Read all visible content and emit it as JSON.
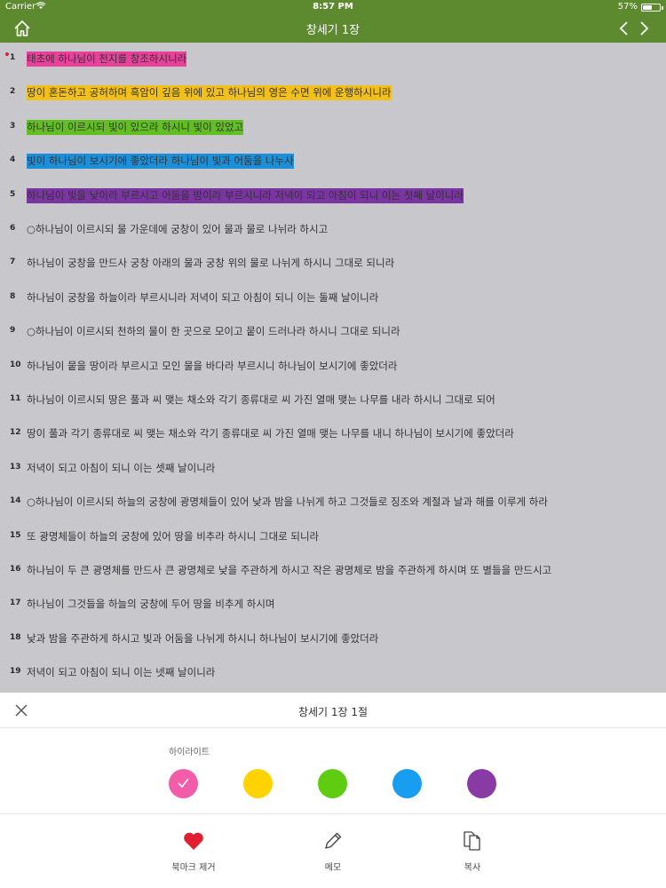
{
  "status": {
    "carrier": "Carrier",
    "time": "8:57 PM",
    "battery": "57%",
    "battery_level": 0.57
  },
  "nav": {
    "title": "창세기 1장"
  },
  "verses": [
    {
      "num": "1",
      "text": "태초에 하나님이 천지를 창조하시니라",
      "highlight": "#e8419b",
      "marked": true
    },
    {
      "num": "2",
      "text": "땅이 혼돈하고 공허하며 흑암이 깊음 위에 있고 하나님의 영은 수면 위에 운행하시니라",
      "highlight": "#f2c018"
    },
    {
      "num": "3",
      "text": "하나님이 이르시되 빛이 있으라 하시니 빛이 있었고",
      "highlight": "#62bf22"
    },
    {
      "num": "4",
      "text": "빛이 하나님이 보시기에 좋았더라 하나님이 빛과 어둠을 나누사",
      "highlight": "#1d8fd8"
    },
    {
      "num": "5",
      "text": "하나님이 빛을 낮이라 부르시고 어둠을 밤이라 부르시니라 저녁이 되고 아침이 되니 이는 첫째 날이니라",
      "highlight": "#7a35a2"
    },
    {
      "num": "6",
      "text": "○하나님이 이르시되 물 가운데에 궁창이 있어 물과 물로 나뉘라 하시고"
    },
    {
      "num": "7",
      "text": "하나님이 궁창을 만드사 궁창 아래의 물과 궁창 위의 물로 나뉘게 하시니 그대로 되니라"
    },
    {
      "num": "8",
      "text": "하나님이 궁창을 하늘이라 부르시니라 저녁이 되고 아침이 되니 이는 둘째 날이니라"
    },
    {
      "num": "9",
      "text": "○하나님이 이르시되 천하의 물이 한 곳으로 모이고 뭍이 드러나라 하시니 그대로 되니라"
    },
    {
      "num": "10",
      "text": "하나님이 뭍을 땅이라 부르시고 모인 물을 바다라 부르시니 하나님이 보시기에 좋았더라"
    },
    {
      "num": "11",
      "text": "하나님이 이르시되 땅은 풀과 씨 맺는 채소와 각기 종류대로 씨 가진 열매 맺는 나무를 내라 하시니 그대로 되어"
    },
    {
      "num": "12",
      "text": "땅이 풀과 각기 종류대로 씨 맺는 채소와 각기 종류대로 씨 가진 열매 맺는 나무를 내니 하나님이 보시기에 좋았더라"
    },
    {
      "num": "13",
      "text": "저녁이 되고 아침이 되니 이는 셋째 날이니라"
    },
    {
      "num": "14",
      "text": "○하나님이 이르시되 하늘의 궁창에 광명체들이 있어 낮과 밤을 나뉘게 하고 그것들로 징조와 계절과 날과 해를 이루게 하라"
    },
    {
      "num": "15",
      "text": "또 광명체들이 하늘의 궁창에 있어 땅을 비추라 하시니 그대로 되니라"
    },
    {
      "num": "16",
      "text": "하나님이 두 큰 광명체를 만드사 큰 광명체로 낮을 주관하게 하시고 작은 광명체로 밤을 주관하게 하시며 또 별들을 만드시고"
    },
    {
      "num": "17",
      "text": "하나님이 그것들을 하늘의 궁창에 두어 땅을 비추게 하시며"
    },
    {
      "num": "18",
      "text": "낮과 밤을 주관하게 하시고 빛과 어둠을 나뉘게 하시니 하나님이 보시기에 좋았더라"
    },
    {
      "num": "19",
      "text": "저녁이 되고 아침이 되니 이는 넷째 날이니라"
    }
  ],
  "sheet": {
    "title": "창세기 1장 1절",
    "highlight_label": "하이라이트",
    "swatches": [
      {
        "name": "pink",
        "color": "#f25ca8",
        "selected": true
      },
      {
        "name": "yellow",
        "color": "#ffd200",
        "selected": false
      },
      {
        "name": "green",
        "color": "#5fcc12",
        "selected": false
      },
      {
        "name": "blue",
        "color": "#189ef0",
        "selected": false
      },
      {
        "name": "purple",
        "color": "#8a3aa5",
        "selected": false
      }
    ],
    "actions": {
      "bookmark": {
        "label": "북마크 제거",
        "icon": "heart-icon",
        "color": "#e0202e"
      },
      "memo": {
        "label": "메모",
        "icon": "pencil-icon"
      },
      "copy": {
        "label": "복사",
        "icon": "copy-icon"
      }
    }
  },
  "colors": {
    "nav_bg": "#5d8a2f",
    "content_bg": "#c7c7cc"
  }
}
